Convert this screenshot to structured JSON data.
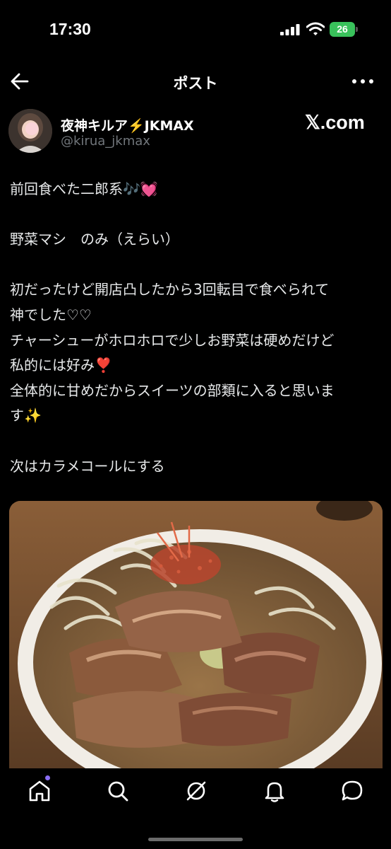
{
  "status_bar": {
    "time": "17:30",
    "battery": "26"
  },
  "nav": {
    "title": "ポスト"
  },
  "author": {
    "display_name": "夜神キルア⚡️JKMAX",
    "handle": "@kirua_jkmax",
    "brand": "𝕏.com"
  },
  "post": {
    "lines": [
      "前回食べた二郎系🎶💓",
      "",
      "野菜マシ　のみ（えらい）",
      "",
      "初だったけど開店凸したから3回転目で食べられて",
      "神でした♡♡",
      "チャーシューがホロホロで少しお野菜は硬めだけど",
      "私的には好み❣️",
      "全体的に甘めだからスイーツの部類に入ると思いま",
      "す✨",
      "",
      "次はカラメコールにする"
    ]
  },
  "colors": {
    "accent": "#8b6ef5",
    "battery": "#39c15b",
    "muted": "#71767b"
  },
  "tabs": [
    "home-icon",
    "search-icon",
    "grok-icon",
    "notifications-icon",
    "messages-icon"
  ]
}
